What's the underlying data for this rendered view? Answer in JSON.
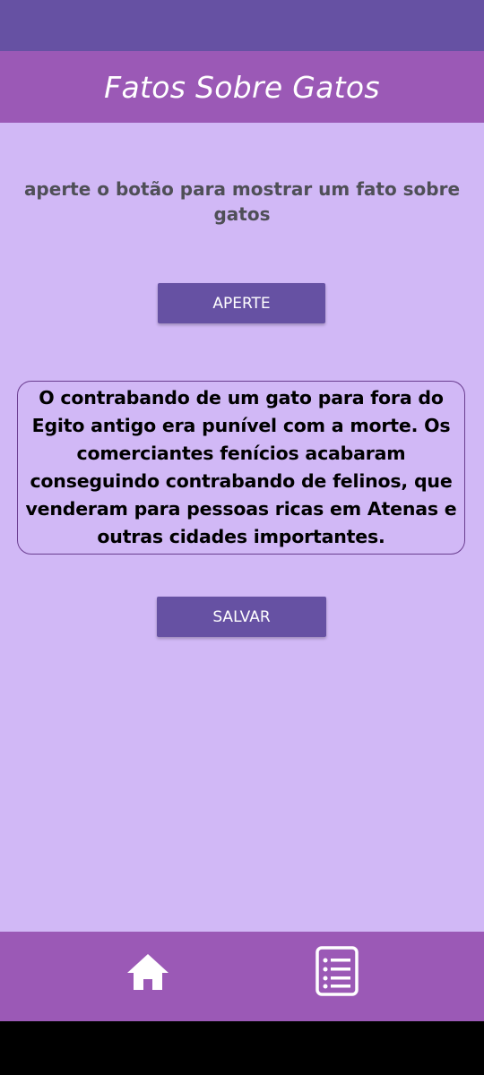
{
  "app_bar": {
    "title": "Fatos Sobre Gatos"
  },
  "main": {
    "instruction": "aperte o botão para mostrar um fato sobre gatos",
    "show_button_label": "APERTE",
    "fact_text": "O contrabando de um gato para fora do Egito antigo era punível com a morte. Os comerciantes fenícios acabaram conseguindo contrabando de felinos, que venderam para pessoas ricas em Atenas e outras cidades importantes.",
    "save_button_label": "SALVAR"
  },
  "bottom_nav": {
    "items": [
      {
        "icon": "home-icon"
      },
      {
        "icon": "list-icon"
      }
    ]
  },
  "colors": {
    "status_bar": "#6651a3",
    "app_bar": "#9b59b6",
    "background": "#d1b8f6",
    "button": "#6651a3",
    "bottom_nav": "#9b59b6"
  }
}
